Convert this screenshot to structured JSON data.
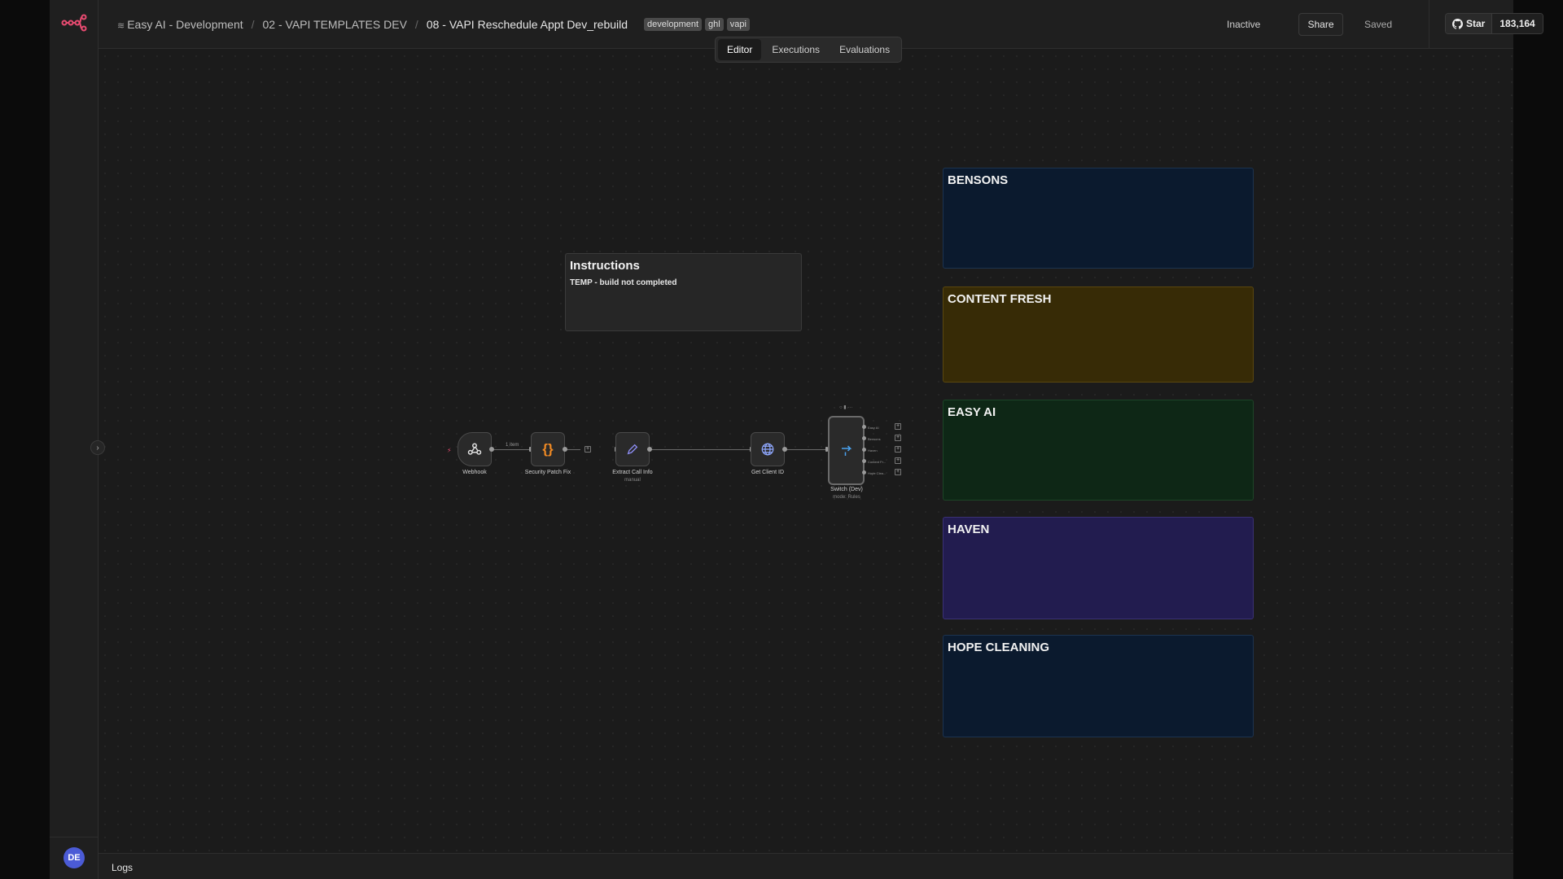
{
  "breadcrumb": {
    "project": "Easy AI - Development",
    "folder": "02 - VAPI TEMPLATES DEV",
    "workflow": "08 - VAPI Reschedule Appt Dev_rebuild"
  },
  "tags": [
    "development",
    "ghl",
    "vapi"
  ],
  "header": {
    "status": "Inactive",
    "share_label": "Share",
    "saved_label": "Saved",
    "star_label": "Star",
    "star_count": "183,164"
  },
  "view_tabs": [
    "Editor",
    "Executions",
    "Evaluations"
  ],
  "instructions_note": {
    "title": "Instructions",
    "body": "TEMP - build not completed"
  },
  "client_notes": [
    {
      "title": "BENSONS",
      "bg": "#0b1a2e",
      "border": "#1c3350"
    },
    {
      "title": "CONTENT FRESH",
      "bg": "#372b06",
      "border": "#5a470e"
    },
    {
      "title": "EASY AI",
      "bg": "#0e2716",
      "border": "#1c4527"
    },
    {
      "title": "HAVEN",
      "bg": "#221c4f",
      "border": "#3a3175"
    },
    {
      "title": "HOPE CLEANING",
      "bg": "#0b1a2e",
      "border": "#1c3350"
    }
  ],
  "nodes": {
    "webhook": {
      "label": "Webhook",
      "icon": "webhook-icon"
    },
    "security": {
      "label": "Security Patch Fix",
      "icon": "code-braces-icon"
    },
    "extract": {
      "label": "Extract Call Info",
      "sub": "manual",
      "icon": "pencil-icon"
    },
    "client": {
      "label": "Get Client ID",
      "icon": "globe-icon"
    },
    "switch": {
      "label": "Switch (Dev)",
      "sub": "mode: Rules",
      "icon": "switch-icon"
    }
  },
  "edge_label": "1 item",
  "switch_outputs": [
    "Easy AI",
    "Bensons",
    "Haven",
    "Content Fr...",
    "Hope Clea..."
  ],
  "avatar_initials": "DE",
  "logs_label": "Logs",
  "colors": {
    "accent": "#ea4b71"
  }
}
